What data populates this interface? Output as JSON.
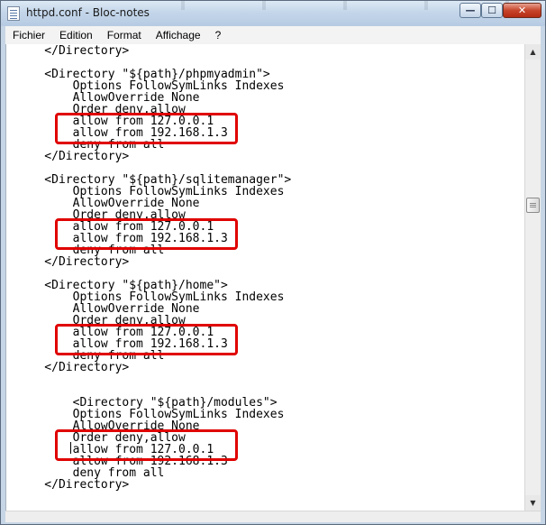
{
  "window": {
    "title": "httpd.conf - Bloc-notes",
    "controls": {
      "minimize": "—",
      "maximize": "☐",
      "close": "✕"
    }
  },
  "menu": {
    "items": [
      "Fichier",
      "Edition",
      "Format",
      "Affichage",
      "?"
    ]
  },
  "document": {
    "lines": [
      "    </Directory>",
      "",
      "    <Directory \"${path}/phpmyadmin\">",
      "        Options FollowSymLinks Indexes",
      "        AllowOverride None",
      "        Order deny,allow",
      "        allow from 127.0.0.1",
      "        allow from 192.168.1.3",
      "        deny from all",
      "    </Directory>",
      "",
      "    <Directory \"${path}/sqlitemanager\">",
      "        Options FollowSymLinks Indexes",
      "        AllowOverride None",
      "        Order deny,allow",
      "        allow from 127.0.0.1",
      "        allow from 192.168.1.3",
      "        deny from all",
      "    </Directory>",
      "",
      "    <Directory \"${path}/home\">",
      "        Options FollowSymLinks Indexes",
      "        AllowOverride None",
      "        Order deny,allow",
      "        allow from 127.0.0.1",
      "        allow from 192.168.1.3",
      "        deny from all",
      "    </Directory>",
      "",
      "",
      "        <Directory \"${path}/modules\">",
      "        Options FollowSymLinks Indexes",
      "        AllowOverride None",
      "        Order deny,allow",
      "        allow from 127.0.0.1",
      "        allow from 192.168.1.3",
      "        deny from all",
      "    </Directory>"
    ]
  },
  "scrollbar": {
    "up": "▲",
    "down": "▼"
  },
  "colors": {
    "highlight": "#e00000",
    "titlebar": "#c4d6ea",
    "close": "#c7452c"
  },
  "icons": [
    "notepad-icon",
    "minimize-icon",
    "maximize-icon",
    "close-icon"
  ]
}
